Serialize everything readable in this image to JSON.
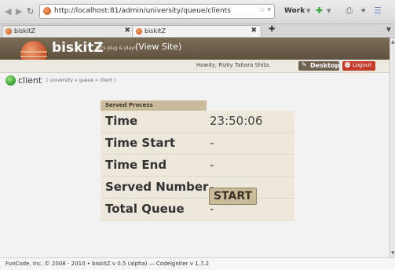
{
  "browser": {
    "url": "http://localhost:81/admin/university/queue/clients",
    "work_label": "Work",
    "tabs": [
      {
        "title": "biskitZ"
      },
      {
        "title": "biskitZ"
      }
    ]
  },
  "header": {
    "brand": "biskitZ",
    "tagline": "let's plug & play!",
    "view_site": "(View Site)"
  },
  "subheader": {
    "greeting": "Howdy, Rizky Tahara Shita.",
    "desktop_label": "Desktop",
    "logout_label": "Logout"
  },
  "page": {
    "heading": "client",
    "breadcrumb": "( university » queue » client )"
  },
  "panel": {
    "title": "Served Process",
    "rows": [
      {
        "label": "Time",
        "value": "23:50:06"
      },
      {
        "label": "Time Start",
        "value": "-"
      },
      {
        "label": "Time End",
        "value": "-"
      },
      {
        "label": "Served Number",
        "value": "-"
      },
      {
        "label": "Total Queue",
        "value": "-"
      }
    ],
    "start_label": "START"
  },
  "footer": {
    "text": "FunCode, Inc. © 2008 - 2010 • biskitZ v 0.5 (alpha) — CodeIgniter v 1.7.2"
  },
  "colors": {
    "header_bg": "#6f6250",
    "panel_bg": "#ece8dc",
    "panel_tab": "#c8bc9c",
    "logout_red": "#c43b2c"
  }
}
